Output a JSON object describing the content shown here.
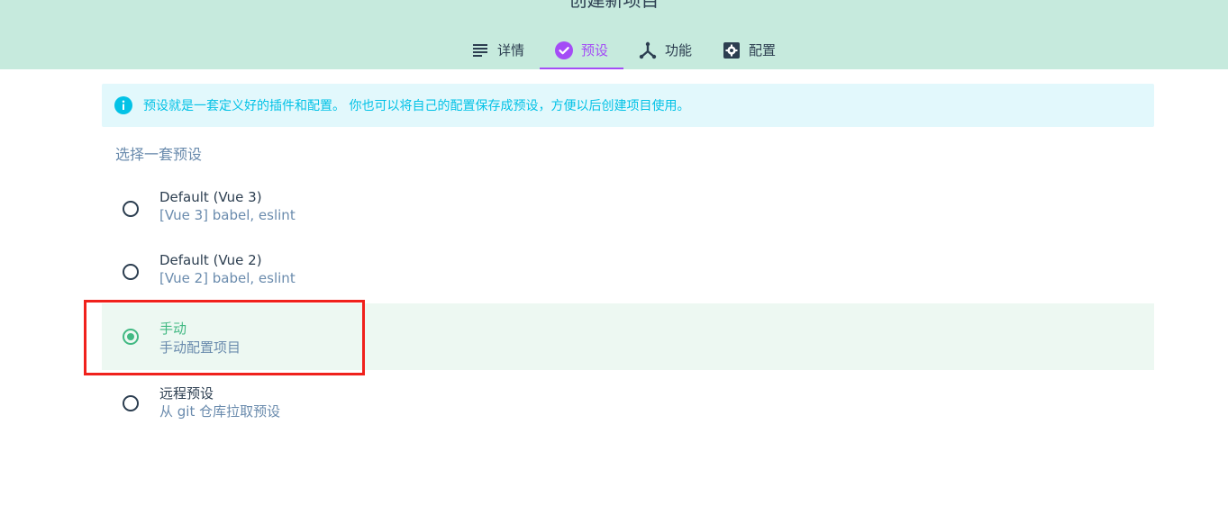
{
  "header": {
    "title": "创建新项目",
    "tabs": [
      {
        "label": "详情",
        "icon": "list-icon",
        "active": false
      },
      {
        "label": "预设",
        "icon": "check-circle-icon",
        "active": true
      },
      {
        "label": "功能",
        "icon": "call-split-icon",
        "active": false
      },
      {
        "label": "配置",
        "icon": "settings-applications-icon",
        "active": false
      }
    ]
  },
  "info": {
    "icon": "info-icon",
    "text": "预设就是一套定义好的插件和配置。 你也可以将自己的配置保存成预设，方便以后创建项目使用。"
  },
  "presets": {
    "label": "选择一套预设",
    "items": [
      {
        "name": "Default (Vue 3)",
        "description": "[Vue 3] babel, eslint",
        "selected": false
      },
      {
        "name": "Default (Vue 2)",
        "description": "[Vue 2] babel, eslint",
        "selected": false
      },
      {
        "name": "手动",
        "description": "手动配置项目",
        "selected": true
      },
      {
        "name": "远程预设",
        "description": "从 git 仓库拉取预设",
        "selected": false
      }
    ]
  },
  "colors": {
    "header_bg": "#c6eadd",
    "accent_purple": "#a44cf6",
    "accent_green": "#42b983",
    "info_text": "#03c2e6",
    "info_bg": "#e2f8fc",
    "highlight_border": "#f0211c"
  }
}
